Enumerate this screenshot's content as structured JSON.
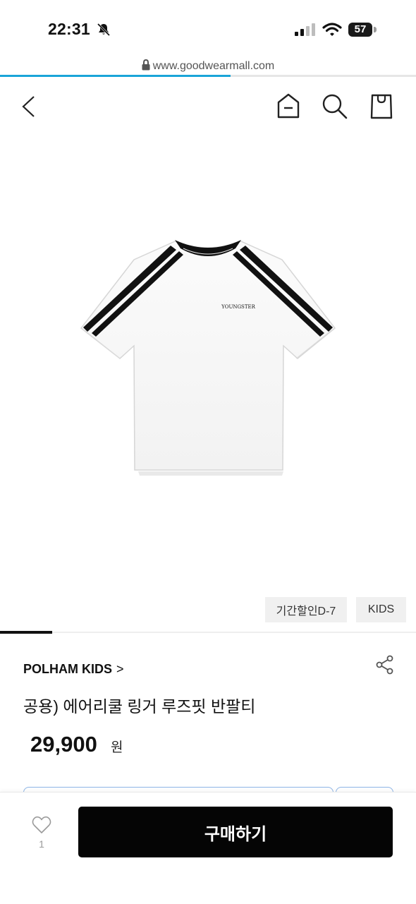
{
  "status_bar": {
    "time": "22:31",
    "battery": "57",
    "icons": [
      "bell-slash-icon",
      "signal-icon",
      "wifi-icon",
      "battery-icon"
    ]
  },
  "browser": {
    "url": "www.goodwearmall.com",
    "load_progress": 0.555,
    "progress_color": "#1aa4d8"
  },
  "header": {
    "icons": [
      "back-chevron-icon",
      "home-icon",
      "search-icon",
      "shopping-bag-icon"
    ]
  },
  "product": {
    "image_icon": "tshirt-image",
    "print_text": "YOUNGSTER",
    "tags": [
      "기간할인D-7",
      "KIDS"
    ],
    "brand": "POLHAM KIDS",
    "brand_chevron": ">",
    "title": "공용) 에어리쿨 링거 루즈핏 반팔티",
    "price": "29,900",
    "currency": "원"
  },
  "bottom_bar": {
    "like_count": "1",
    "buy_label": "구매하기"
  },
  "colors": {
    "accent": "#1aa4d8",
    "buy_button": "#050505",
    "tag_bg": "#f0f0f0",
    "option_border": "#8cb4e6"
  }
}
